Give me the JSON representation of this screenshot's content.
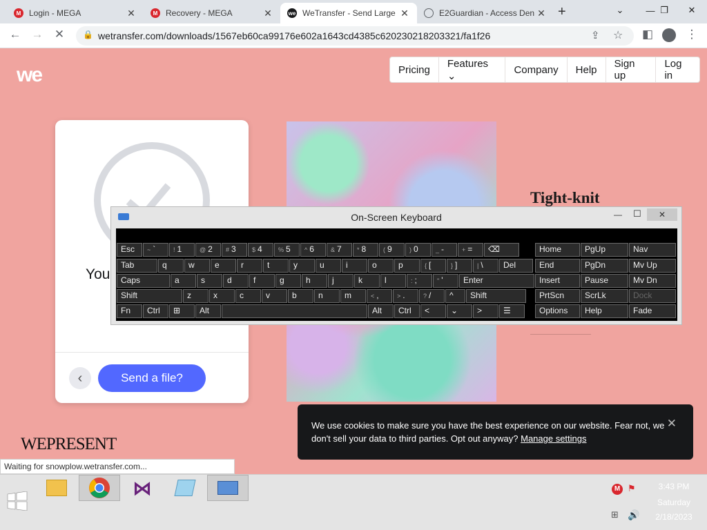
{
  "browser": {
    "tabs": [
      {
        "label": "Login - MEGA",
        "close": "✕",
        "favicon": "M",
        "favicon_color": "#d9272e"
      },
      {
        "label": "Recovery - MEGA",
        "close": "✕",
        "favicon": "M",
        "favicon_color": "#d9272e"
      },
      {
        "label": "WeTransfer - Send Large",
        "close": "✕",
        "favicon": "we",
        "favicon_color": "#17181a"
      },
      {
        "label": "E2Guardian - Access Den",
        "close": "✕",
        "favicon": "globe",
        "favicon_color": "#5f6368"
      }
    ],
    "new_tab": "+",
    "url": "wetransfer.com/downloads/1567eb60ca99176e602a1643cd4385c620230218203321/fa1f26"
  },
  "page": {
    "logo": "we",
    "nav": [
      "Pricing",
      "Features ⌄",
      "Company",
      "Help",
      "Sign up",
      "Log in"
    ],
    "card": {
      "heading_partial": "You",
      "send_button": "Send a file?",
      "back": "‹"
    },
    "tight_knit": "Tight-knit",
    "wepresent": "WEPRESENT",
    "status_bar": "Waiting for snowplow.wetransfer.com...",
    "cookie": {
      "text": "We use cookies to make sure you have the best experience on our website. Fear not, we don't sell your data to third parties. Opt out anyway?",
      "link": "Manage settings",
      "close": "✕"
    }
  },
  "osk": {
    "title": "On-Screen Keyboard",
    "window_buttons": [
      "—",
      "☐",
      "✕"
    ],
    "rows": [
      [
        {
          "k": "Esc"
        },
        {
          "s": "~",
          "k": "`"
        },
        {
          "s": "!",
          "k": "1"
        },
        {
          "s": "@",
          "k": "2"
        },
        {
          "s": "#",
          "k": "3"
        },
        {
          "s": "$",
          "k": "4"
        },
        {
          "s": "%",
          "k": "5"
        },
        {
          "s": "^",
          "k": "6"
        },
        {
          "s": "&",
          "k": "7"
        },
        {
          "s": "*",
          "k": "8"
        },
        {
          "s": "(",
          "k": "9"
        },
        {
          "s": ")",
          "k": "0"
        },
        {
          "s": "_",
          "k": "-"
        },
        {
          "s": "+",
          "k": "="
        },
        {
          "k": "⌫"
        }
      ],
      [
        {
          "k": "Tab"
        },
        {
          "k": "q"
        },
        {
          "k": "w"
        },
        {
          "k": "e"
        },
        {
          "k": "r"
        },
        {
          "k": "t"
        },
        {
          "k": "y"
        },
        {
          "k": "u"
        },
        {
          "k": "i"
        },
        {
          "k": "o"
        },
        {
          "k": "p"
        },
        {
          "s": "{",
          "k": "["
        },
        {
          "s": "}",
          "k": "]"
        },
        {
          "s": "|",
          "k": "\\"
        },
        {
          "k": "Del"
        }
      ],
      [
        {
          "k": "Caps"
        },
        {
          "k": "a"
        },
        {
          "k": "s"
        },
        {
          "k": "d"
        },
        {
          "k": "f"
        },
        {
          "k": "g"
        },
        {
          "k": "h"
        },
        {
          "k": "j"
        },
        {
          "k": "k"
        },
        {
          "k": "l"
        },
        {
          "s": ":",
          "k": ";"
        },
        {
          "s": "\"",
          "k": "'"
        },
        {
          "k": "Enter"
        }
      ],
      [
        {
          "k": "Shift"
        },
        {
          "k": "z"
        },
        {
          "k": "x"
        },
        {
          "k": "c"
        },
        {
          "k": "v"
        },
        {
          "k": "b"
        },
        {
          "k": "n"
        },
        {
          "k": "m"
        },
        {
          "s": "<",
          "k": ","
        },
        {
          "s": ">",
          "k": "."
        },
        {
          "s": "?",
          "k": "/"
        },
        {
          "k": "^"
        },
        {
          "k": "Shift"
        }
      ],
      [
        {
          "k": "Fn"
        },
        {
          "k": "Ctrl"
        },
        {
          "k": "⊞"
        },
        {
          "k": "Alt"
        },
        {
          "k": ""
        },
        {
          "k": "Alt"
        },
        {
          "k": "Ctrl"
        },
        {
          "k": "<"
        },
        {
          "k": "⌄"
        },
        {
          "k": ">"
        },
        {
          "k": "☰"
        }
      ]
    ],
    "nav_keys": [
      [
        "Home",
        "PgUp",
        "Nav"
      ],
      [
        "End",
        "PgDn",
        "Mv Up"
      ],
      [
        "Insert",
        "Pause",
        "Mv Dn"
      ],
      [
        "PrtScn",
        "ScrLk",
        "Dock"
      ],
      [
        "Options",
        "Help",
        "Fade"
      ]
    ]
  },
  "taskbar": {
    "time": "3:43 PM",
    "day": "Saturday",
    "date": "2/18/2023"
  }
}
